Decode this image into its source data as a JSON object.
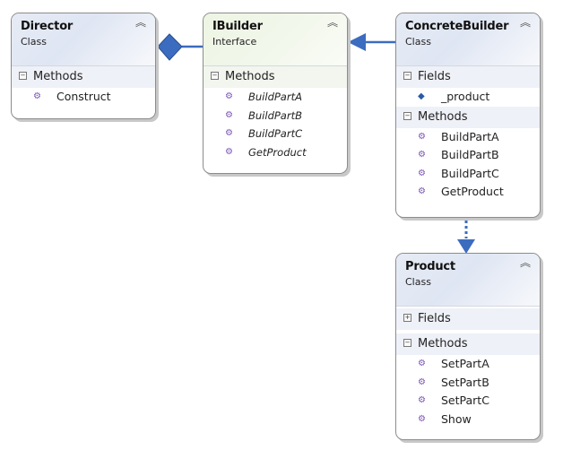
{
  "diagram": {
    "classes": {
      "director": {
        "name": "Director",
        "stereotype": "Class",
        "collapse_icon": "double-chevron-up-icon",
        "sections": {
          "methods": {
            "label": "Methods",
            "toggle": "⊟",
            "items": [
              "Construct"
            ]
          }
        }
      },
      "ibuilder": {
        "name": "IBuilder",
        "stereotype": "Interface",
        "collapse_icon": "double-chevron-up-icon",
        "sections": {
          "methods": {
            "label": "Methods",
            "toggle": "⊟",
            "items": [
              "BuildPartA",
              "BuildPartB",
              "BuildPartC",
              "GetProduct"
            ]
          }
        }
      },
      "concrete_builder": {
        "name": "ConcreteBuilder",
        "stereotype": "Class",
        "collapse_icon": "double-chevron-up-icon",
        "sections": {
          "fields": {
            "label": "Fields",
            "toggle": "⊟",
            "items": [
              "_product"
            ]
          },
          "methods": {
            "label": "Methods",
            "toggle": "⊟",
            "items": [
              "BuildPartA",
              "BuildPartB",
              "BuildPartC",
              "GetProduct"
            ]
          }
        }
      },
      "product": {
        "name": "Product",
        "stereotype": "Class",
        "collapse_icon": "double-chevron-up-icon",
        "sections": {
          "fields": {
            "label": "Fields",
            "toggle": "⊞",
            "collapsed": true
          },
          "methods": {
            "label": "Methods",
            "toggle": "⊟",
            "items": [
              "SetPartA",
              "SetPartB",
              "SetPartC",
              "Show"
            ]
          }
        }
      }
    },
    "relationships": [
      {
        "type": "composition",
        "from": "Director",
        "to": "IBuilder"
      },
      {
        "type": "realization",
        "from": "ConcreteBuilder",
        "to": "IBuilder"
      },
      {
        "type": "dependency",
        "from": "ConcreteBuilder",
        "to": "Product"
      }
    ],
    "colors": {
      "connector": "#3b6cc0",
      "method_icon": "#7a52b3",
      "field_icon": "#2a5aa6",
      "class_header": "#e2e8f4",
      "interface_header": "#eef5e4"
    },
    "glyphs": {
      "collapse": "︽",
      "method": "⚙",
      "field": "◆"
    }
  }
}
